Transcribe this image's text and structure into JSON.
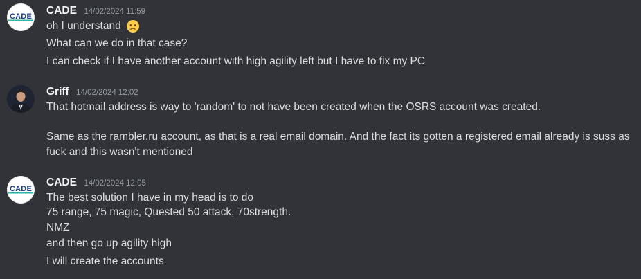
{
  "messages": [
    {
      "author": "CADE",
      "timestamp": "14/02/2024 11:59",
      "avatar_text": "CADE",
      "lines": [
        "oh I understand",
        "What can we do in that case?",
        "I can check if I have another account with high agility left but I have to fix my PC"
      ]
    },
    {
      "author": "Griff",
      "timestamp": "14/02/2024 12:02",
      "lines": [
        "That hotmail address is way to 'random' to not have been created when the OSRS account was created.",
        "Same as the rambler.ru account, as that is a real email domain. And the fact its gotten a registered email already is suss as",
        "fuck and this wasn't mentioned"
      ]
    },
    {
      "author": "CADE",
      "timestamp": "14/02/2024 12:05",
      "avatar_text": "CADE",
      "lines": [
        "The best solution I have in my head is to do",
        "75 range, 75 magic, Quested 50 attack, 70strength.",
        "NMZ",
        "and then go up agility high",
        "I will create the accounts"
      ]
    }
  ],
  "emoji": "crying-face-emoji"
}
